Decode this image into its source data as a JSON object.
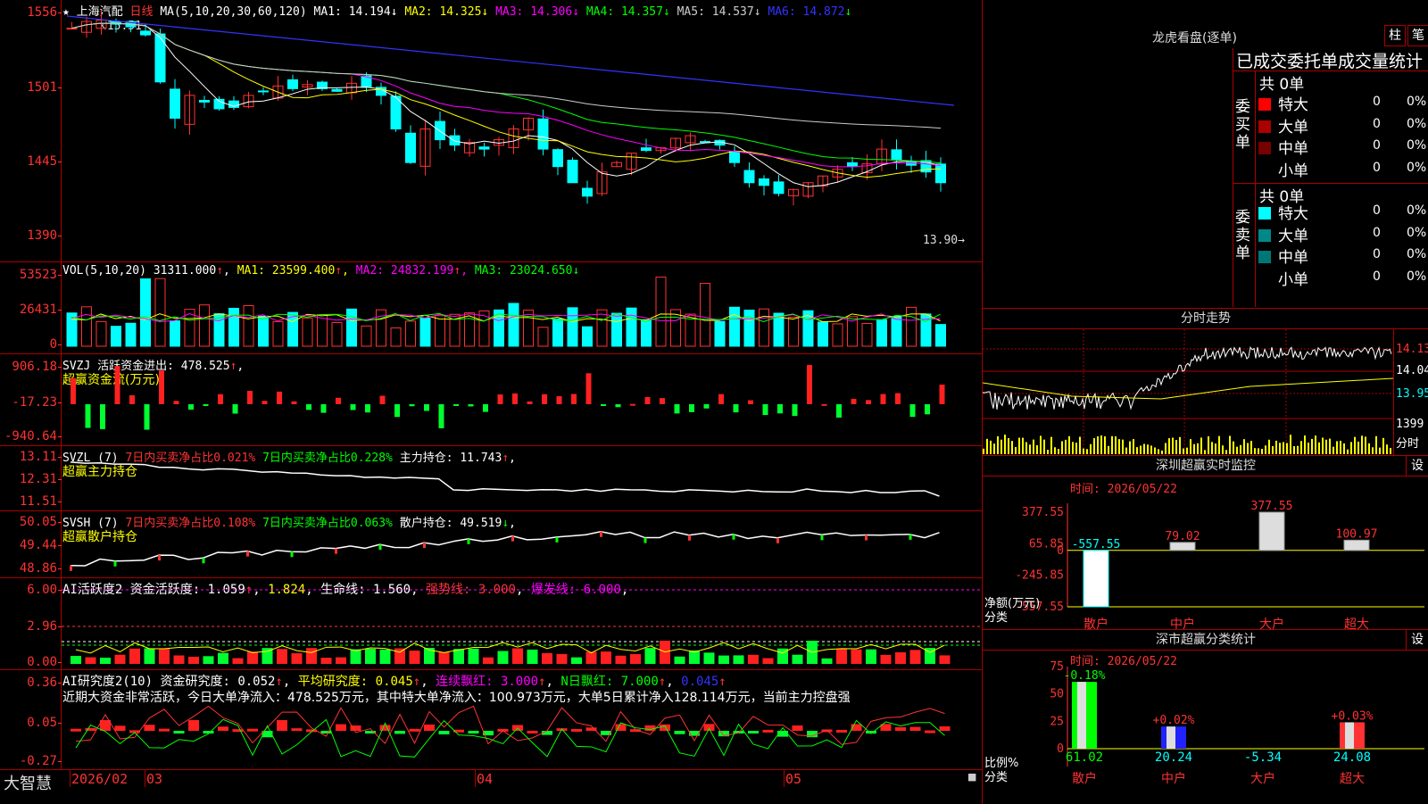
{
  "header": {
    "stock_name": "上海汽配",
    "period": "日线",
    "ma_formula": "MA(5,10,20,30,60,120)",
    "ma_values": [
      {
        "name": "MA1",
        "value": "14.194",
        "arrow": "↓",
        "color": "#ffffff"
      },
      {
        "name": "MA2",
        "value": "14.325",
        "arrow": "↓",
        "color": "#ffff00"
      },
      {
        "name": "MA3",
        "value": "14.306",
        "arrow": "↓",
        "color": "#ff00ff"
      },
      {
        "name": "MA4",
        "value": "14.357",
        "arrow": "↓",
        "color": "#00ff00"
      },
      {
        "name": "MA5",
        "value": "14.537",
        "arrow": "↓",
        "color": "#cccccc"
      },
      {
        "name": "MA6",
        "value": "14.872",
        "arrow": "↓",
        "color": "#3333ff"
      }
    ],
    "high_marker": "15.51",
    "low_marker": "13.90"
  },
  "price_axis": [
    "1556",
    "1501",
    "1445",
    "1390"
  ],
  "vol": {
    "title": "VOL(5,10,20)",
    "value": "31311.000",
    "arrow": "↑",
    "ma1": "23599.400",
    "ma1_arrow": "↑",
    "ma2": "24832.199",
    "ma2_arrow": "↑",
    "ma3": "23024.650",
    "ma3_arrow": "↓",
    "axis": [
      "53523",
      "26431",
      "0"
    ]
  },
  "svzj": {
    "title": "SVZJ",
    "label": "活跃资金进出:",
    "value": "478.525",
    "arrow": "↑",
    "subtitle": "超赢资金流(万元)",
    "axis": [
      "906.18",
      "-17.23",
      "-940.64"
    ]
  },
  "svzl": {
    "title": "SVZL (7)",
    "a": "7日内买卖净占比0.021%",
    "b": "7日内买卖净占比0.228%",
    "c_label": "主力持仓:",
    "c_value": "11.743",
    "c_arrow": "↑",
    "subtitle": "超赢主力持仓",
    "axis": [
      "13.11",
      "12.31",
      "11.51"
    ]
  },
  "svsh": {
    "title": "SVSH (7)",
    "a": "7日内买卖净占比0.108%",
    "b": "7日内买卖净占比0.063%",
    "c_label": "散户持仓:",
    "c_value": "49.519",
    "c_arrow": "↓",
    "subtitle": "超赢散户持仓",
    "axis": [
      "50.05",
      "49.44",
      "48.86"
    ]
  },
  "ai_active": {
    "title": "AI活跃度2",
    "label": "资金活跃度:",
    "v1": "1.059",
    "v2": "1.824",
    "life_label": "生命线:",
    "life": "1.560",
    "strong": "强势线: 3.000",
    "burst": "爆发线: 6.000",
    "axis": [
      "6.00",
      "2.96",
      "0.00"
    ]
  },
  "ai_research": {
    "title": "AI研究度2(10)",
    "label": "资金研究度:",
    "v1": "0.052",
    "avg": "平均研究度: 0.045",
    "red": "连续飘红: 3.000",
    "nred": "N日飘红: 7.000",
    "last": "0.045",
    "note": "近期大资金非常活跃，今日大单净流入：478.525万元，其中特大单净流入：100.973万元，大单5日累计净入128.114万元，当前主力控盘强",
    "axis": [
      "0.36",
      "0.05",
      "-0.27"
    ]
  },
  "bottom_bar": {
    "brand": "大智慧",
    "dates": [
      "2026/02",
      "03",
      "04",
      "05"
    ]
  },
  "lhb": {
    "title": "龙虎看盘(逐单)",
    "btn1": "柱",
    "btn2": "笔",
    "subtitle": "已成交委托单成交量统计",
    "buy_label": "委买单",
    "sell_label": "委卖单",
    "buy_total": "共 0单",
    "sell_total": "共 0单",
    "buy_rows": [
      {
        "name": "特大",
        "color": "#ff0000",
        "count": "0",
        "pct": "0%"
      },
      {
        "name": "大单",
        "color": "#aa0000",
        "count": "0",
        "pct": "0%"
      },
      {
        "name": "中单",
        "color": "#770000",
        "count": "0",
        "pct": "0%"
      },
      {
        "name": "小单",
        "color": "#000000",
        "count": "0",
        "pct": "0%"
      }
    ],
    "sell_rows": [
      {
        "name": "特大",
        "color": "#00ffff",
        "count": "0",
        "pct": "0%"
      },
      {
        "name": "大单",
        "color": "#008888",
        "count": "0",
        "pct": "0%"
      },
      {
        "name": "中单",
        "color": "#007777",
        "count": "0",
        "pct": "0%"
      },
      {
        "name": "小单",
        "color": "#000000",
        "count": "0",
        "pct": "0%"
      }
    ]
  },
  "fenshi": {
    "title": "分时走势",
    "axis": [
      "14.13",
      "14.04",
      "13.95"
    ],
    "vol_label": "1399",
    "unit": "分时"
  },
  "monitor": {
    "title": "深圳超赢实时监控",
    "set": "设",
    "time": "时间: 2026/05/22",
    "axis": [
      "377.55",
      "65.85",
      "0",
      "-245.85",
      "-557.55"
    ],
    "ylabel": "净额(万元)",
    "xlabel": "分类",
    "bars": [
      {
        "name": "散户",
        "value": -557.55,
        "label": "-557.55"
      },
      {
        "name": "中户",
        "value": 79.02,
        "label": "79.02"
      },
      {
        "name": "大户",
        "value": 377.55,
        "label": "377.55"
      },
      {
        "name": "超大",
        "value": 100.97,
        "label": "100.97"
      }
    ]
  },
  "classify": {
    "title": "深市超赢分类统计",
    "set": "设",
    "time": "时间: 2026/05/22",
    "axis": [
      "75",
      "50",
      "25",
      "0"
    ],
    "ylabel": "比例%",
    "xlabel": "分类",
    "bars": [
      {
        "name": "散户",
        "value": 61.02,
        "label": "61.02",
        "top": "-0.18%"
      },
      {
        "name": "中户",
        "value": 20.24,
        "label": "20.24",
        "top": "+0.02%"
      },
      {
        "name": "大户",
        "value": -5.34,
        "label": "-5.34",
        "top": ""
      },
      {
        "name": "超大",
        "value": 24.08,
        "label": "24.08",
        "top": "+0.03%"
      }
    ]
  },
  "chart_data": {
    "type": "candlestick",
    "x": [
      "2026/02",
      "03",
      "04",
      "05"
    ],
    "ylim": [
      13.9,
      15.56
    ]
  }
}
